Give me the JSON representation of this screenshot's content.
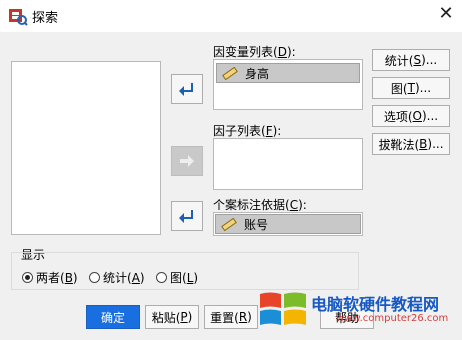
{
  "window": {
    "title": "探索",
    "close_glyph": "✕"
  },
  "dependent_list": {
    "label": "因变量列表(",
    "key": "D",
    "suffix": "):",
    "items": [
      "身高"
    ]
  },
  "factor_list": {
    "label": "因子列表(",
    "key": "F",
    "suffix": "):"
  },
  "case_label": {
    "label": "个案标注依据(",
    "key": "C",
    "suffix": "):",
    "item": "账号"
  },
  "side_buttons": [
    {
      "label": "统计(",
      "key": "S",
      "suffix": ")..."
    },
    {
      "label": "图(",
      "key": "T",
      "suffix": ")..."
    },
    {
      "label": "选项(",
      "key": "O",
      "suffix": ")..."
    },
    {
      "label": "拔靴法(",
      "key": "B",
      "suffix": ")..."
    }
  ],
  "display_group": {
    "label": "显示",
    "options": [
      {
        "label": "两者(",
        "key": "B",
        "suffix": ")",
        "selected": true
      },
      {
        "label": "统计(",
        "key": "A",
        "suffix": ")",
        "selected": false
      },
      {
        "label": "图(",
        "key": "L",
        "suffix": ")",
        "selected": false
      }
    ]
  },
  "bottom_buttons": {
    "ok": "确定",
    "paste": {
      "label": "粘贴(",
      "key": "P",
      "suffix": ")"
    },
    "reset": {
      "label": "重置(",
      "key": "R",
      "suffix": ")"
    },
    "help": "帮助"
  },
  "watermark": {
    "text": "电脑软硬件教程网",
    "url": "www.computer26.com"
  },
  "colors": {
    "accent": "#1a6fe0",
    "arrow": "#1a5fb4",
    "selected_bg": "#c8c8c8"
  },
  "icons": {
    "arrow": "arrow-right-down-icon",
    "scale_var": "ruler-icon"
  }
}
